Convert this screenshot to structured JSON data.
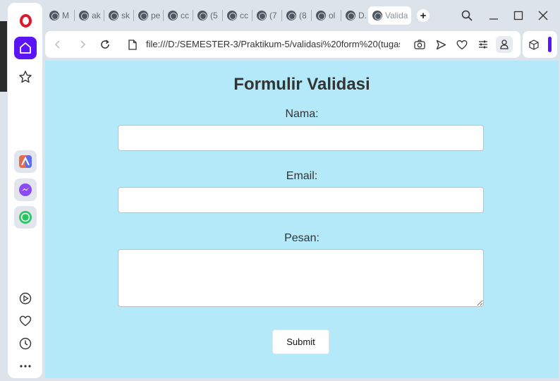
{
  "browser": {
    "tabs": [
      {
        "label": "M"
      },
      {
        "label": "ak"
      },
      {
        "label": "sk"
      },
      {
        "label": "pe"
      },
      {
        "label": "cc"
      },
      {
        "label": "(5"
      },
      {
        "label": "cc"
      },
      {
        "label": "(7"
      },
      {
        "label": "(8"
      },
      {
        "label": "ol"
      },
      {
        "label": "D."
      },
      {
        "label": "Valida",
        "active": true
      }
    ],
    "new_tab_label": "+",
    "address_url": "file:///D:/SEMESTER-3/Praktikum-5/validasi%20form%20(tugas",
    "accent_color": "#5a14f5",
    "opera_red": "#e0162b"
  },
  "sidebar": {
    "apps": [
      "aria-icon",
      "messenger-icon",
      "whatsapp-icon"
    ],
    "bottom": [
      "player-icon",
      "heart-icon",
      "history-icon",
      "more-icon"
    ]
  },
  "page": {
    "background": "#b3e9f9",
    "title": "Formulir Validasi",
    "fields": [
      {
        "label": "Nama:",
        "value": "",
        "type": "input"
      },
      {
        "label": "Email:",
        "value": "",
        "type": "input"
      },
      {
        "label": "Pesan:",
        "value": "",
        "type": "textarea"
      }
    ],
    "submit_label": "Submit"
  }
}
